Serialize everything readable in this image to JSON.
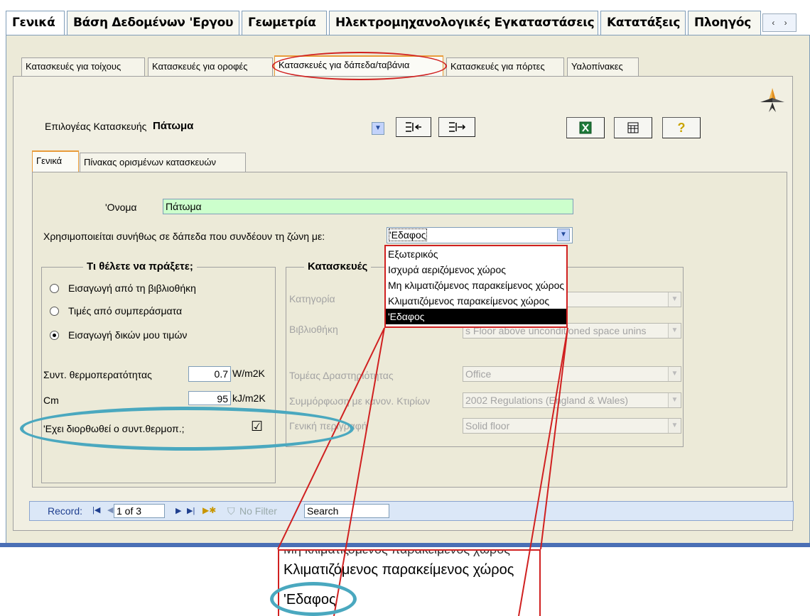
{
  "top_tabs": [
    "Γενικά",
    "Βάση Δεδομένων 'Εργου",
    "Γεωμετρία",
    "Ηλεκτρομηχανολογικές Εγκαταστάσεις",
    "Κατατάξεις",
    "Πλοηγός"
  ],
  "top_scroll": {
    "left": "‹",
    "right": "›"
  },
  "sub_tabs": [
    "Κατασκευές για τοίχους",
    "Κατασκευές για οροφές",
    "Κατασκευές για δάπεδα/ταβάνια",
    "Κατασκευές για πόρτες",
    "Υαλοπίνακες"
  ],
  "selector": {
    "label": "Επιλογέας Κατασκευής",
    "value": "Πάτωμα"
  },
  "inner_tabs": [
    "Γενικά",
    "Πίνακας ορισμένων κατασκευών"
  ],
  "form": {
    "name_label": "'Ονομα",
    "name_value": "Πάτωμα",
    "zone_label": "Χρησιμοποιείται συνήθως σε δάπεδα  που συνδέουν τη ζώνη με:",
    "zone_value": "'Εδαφος"
  },
  "dropdown_options": [
    "Εξωτερικός",
    "Ισχυρά αεριζόμενος χώρος",
    "Μη κλιματιζόμενος παρακείμενος χώρος",
    "Κλιματιζόμενος παρακείμενος  χώρος",
    "'Εδαφος"
  ],
  "what_to_do": {
    "title": "Τι θέλετε να πράξετε;",
    "options": [
      "Εισαγωγή από τη βιβλιοθήκη",
      "Τιμές από συμπεράσματα",
      "Εισαγωγή δικών μου τιμών"
    ],
    "selected_index": 2
  },
  "uvalue": {
    "label": "Συντ. θερμοπερατότητας",
    "value": "0.7",
    "unit": "W/m2K"
  },
  "cm": {
    "label": "Cm",
    "value": "95",
    "unit": "kJ/m2K"
  },
  "corrected": {
    "label": "'Εχει διορθωθεί ο συντ.θερμοπ.;",
    "checked": true,
    "mark": "☑"
  },
  "constructions": {
    "title": "Κατασκευές",
    "category_label": "Κατηγορία",
    "library_label": "Βιβλιοθήκη",
    "library_value": "s Floor above unconditioned space unins",
    "sector_label": "Τομέας Δραστηριότητας",
    "sector_value": "Office",
    "compliance_label": "Συμμόρφωση με κανον. Κτιρίων",
    "compliance_value": "2002 Regulations (England & Wales)",
    "general_label": "Γενική περιγραφή",
    "general_value": "Solid floor"
  },
  "record_bar": {
    "record_label": "Record:",
    "record_value": "1 of 3",
    "nofilter": "No Filter",
    "search": "Search"
  },
  "zoom": {
    "top_partial": "Μη κλιματιζόμενος παρακείμενος χώρος",
    "line1": "Κλιματιζόμενος παρακείμενος  χώρος",
    "line2": "'Εδαφος"
  },
  "colors": {
    "highlight_red": "#d02020",
    "ellipse_teal": "#4aa8bf",
    "name_field_green": "#ccffcc"
  }
}
